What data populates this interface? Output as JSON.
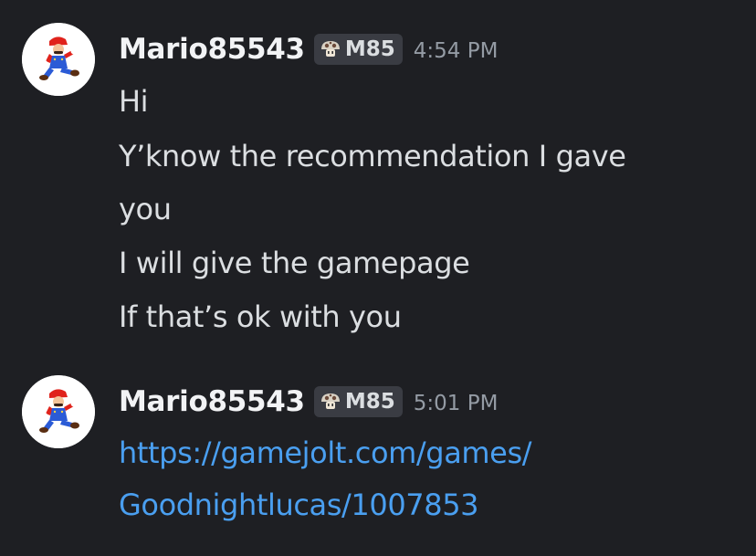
{
  "colors": {
    "background": "#1e1f23",
    "username": "#f2f3f5",
    "message_text": "#dbdee1",
    "timestamp": "#949ba4",
    "tag_background": "#3a3c43",
    "link": "#4a9ff0"
  },
  "messages": [
    {
      "author": "Mario85543",
      "tag": "M85",
      "tag_icon": "mushroom-icon",
      "avatar_icon": "mario-avatar-icon",
      "timestamp": "4:54 PM",
      "lines": [
        "Hi",
        "Y’know the recommendation I gave",
        "you",
        "I will give the gamepage",
        "If that’s ok with you"
      ]
    },
    {
      "author": "Mario85543",
      "tag": "M85",
      "tag_icon": "mushroom-icon",
      "avatar_icon": "mario-avatar-icon",
      "timestamp": "5:01 PM",
      "link_lines": [
        "https://gamejolt.com/games/",
        "Goodnightlucas/1007853"
      ]
    }
  ]
}
